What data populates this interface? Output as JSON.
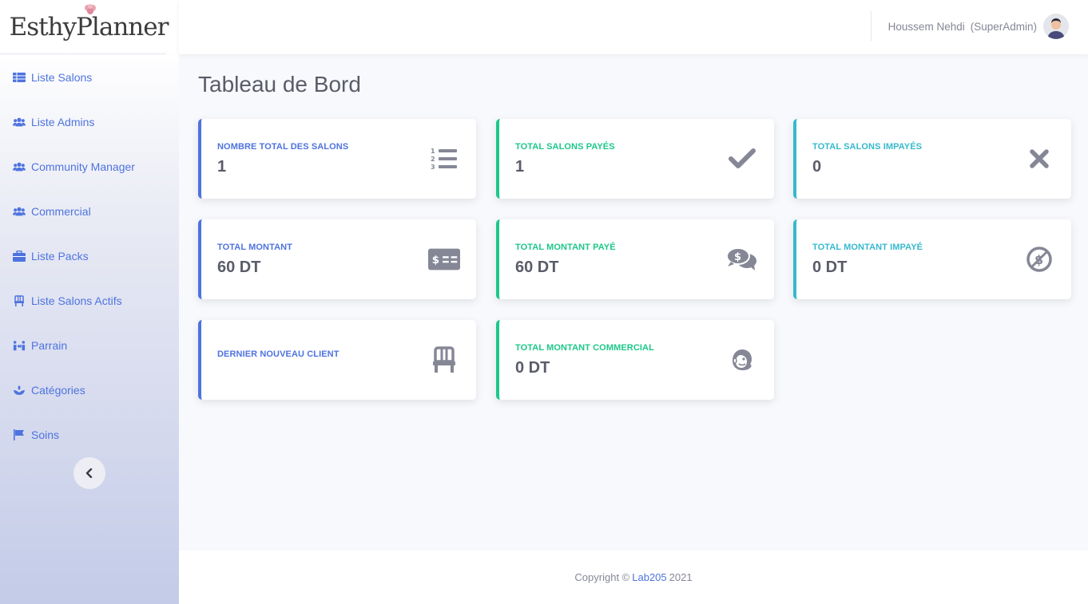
{
  "brand": {
    "name": "EsthyPlanner"
  },
  "sidebar": {
    "items": [
      {
        "label": "Liste Salons",
        "icon": "table-icon"
      },
      {
        "label": "Liste Admins",
        "icon": "users-icon"
      },
      {
        "label": "Community Manager",
        "icon": "users-icon"
      },
      {
        "label": "Commercial",
        "icon": "users-icon"
      },
      {
        "label": "Liste Packs",
        "icon": "briefcase-icon"
      },
      {
        "label": "Liste Salons Actifs",
        "icon": "chair-icon"
      },
      {
        "label": "Parrain",
        "icon": "people-arrows-icon"
      },
      {
        "label": "Catégories",
        "icon": "spa-icon"
      },
      {
        "label": "Soins",
        "icon": "flag-icon"
      }
    ],
    "collapse_icon": "chevron-left-icon"
  },
  "topbar": {
    "user_name": "Houssem Nehdi",
    "user_role": "(SuperAdmin)"
  },
  "page": {
    "title": "Tableau de Bord"
  },
  "cards": [
    {
      "label": "Nombre total des salons",
      "value": "1",
      "icon": "list-ol-icon",
      "color": "#4e73df"
    },
    {
      "label": "Total salons payés",
      "value": "1",
      "icon": "check-icon",
      "color": "#1cc88a"
    },
    {
      "label": "Total salons impayés",
      "value": "0",
      "icon": "times-icon",
      "color": "#36b9cc"
    },
    {
      "label": "Total montant",
      "value": "60 DT",
      "icon": "money-check-icon",
      "color": "#4e73df"
    },
    {
      "label": "Total montant payé",
      "value": "60 DT",
      "icon": "comments-dollar-icon",
      "color": "#1cc88a"
    },
    {
      "label": "Total montant impayé",
      "value": "0 DT",
      "icon": "no-dollar-icon",
      "color": "#36b9cc"
    },
    {
      "label": "Dernier nouveau client",
      "value": "",
      "icon": "chair-icon",
      "color": "#4e73df"
    },
    {
      "label": "Total montant commercial",
      "value": "0 DT",
      "icon": "mailchimp-icon",
      "color": "#1cc88a"
    }
  ],
  "footer": {
    "prefix": "Copyright ©",
    "link": "Lab205",
    "year": "2021"
  },
  "colors": {
    "primary": "#4e73df",
    "success": "#1cc88a",
    "info": "#36b9cc",
    "icon_gray": "#858796"
  }
}
